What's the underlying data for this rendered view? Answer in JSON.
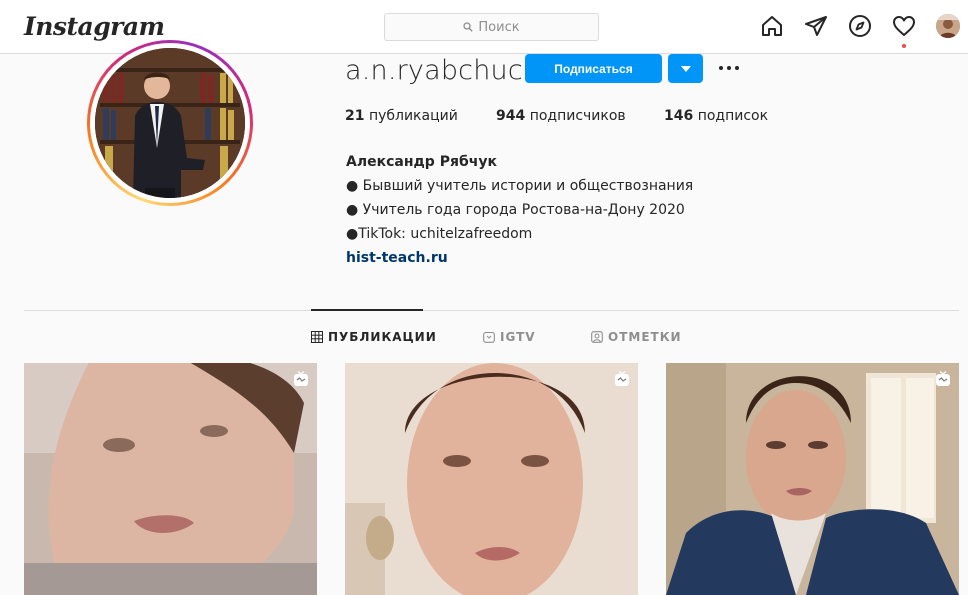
{
  "header": {
    "logo": "Instagram",
    "search_placeholder": "Поиск",
    "icons": [
      "home-icon",
      "direct-icon",
      "explore-icon",
      "activity-heart-icon",
      "profile-avatar"
    ]
  },
  "profile": {
    "username": "a.n.ryabchuck",
    "follow_label": "Подписаться",
    "stats": [
      {
        "count": "21",
        "label": "публикаций"
      },
      {
        "count": "944",
        "label": "подписчиков"
      },
      {
        "count": "146",
        "label": "подписок"
      }
    ],
    "full_name": "Александр Рябчук",
    "bio_lines": [
      "● Бывший учитель истории и обществознания",
      "● Учитель года города Ростова-на-Дону 2020",
      "●TikTok: uchitelzafreedom"
    ],
    "website": "hist-teach.ru"
  },
  "tabs": [
    {
      "label": "ПУБЛИКАЦИИ",
      "icon": "grid-icon",
      "active": true
    },
    {
      "label": "IGTV",
      "icon": "igtv-icon",
      "active": false
    },
    {
      "label": "ОТМЕТКИ",
      "icon": "tagged-icon",
      "active": false
    }
  ],
  "colors": {
    "accent": "#0095f6",
    "link": "#00376b",
    "notification": "#ed4956"
  }
}
